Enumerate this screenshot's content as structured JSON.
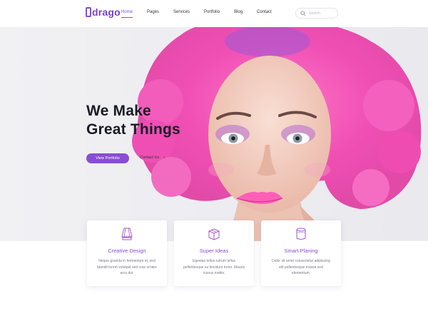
{
  "header": {
    "logo_text": "drago",
    "nav": [
      "Home",
      "Pages",
      "Services",
      "Portfolio",
      "Blog",
      "Contact"
    ],
    "active_nav": "Home",
    "search": {
      "placeholder": "Search"
    }
  },
  "hero": {
    "title_line1": "We Make",
    "title_line2": "Great Things",
    "primary_button": "View Portfolio",
    "secondary_button": "Contact Us"
  },
  "features": [
    {
      "icon": "lamp-icon",
      "title": "Creative Design",
      "text": "Neque gravida in fermentum et, sed blandit lorem volutpat sed cras ornare arcu dui."
    },
    {
      "icon": "box-icon",
      "title": "Super Ideas",
      "text": "Egestas tellus rutrum tellus pellentesque eu tincidunt tortor. Mauris cursus mattis."
    },
    {
      "icon": "cylinder-icon",
      "title": "Smart Planing",
      "text": "Dolor sit amet consectetur adipiscing elit pellentesque massa sed elementum."
    }
  ],
  "colors": {
    "accent": "#8a4cd6",
    "hair": "#f04fb4",
    "hero_bg": "#eeeef2"
  }
}
